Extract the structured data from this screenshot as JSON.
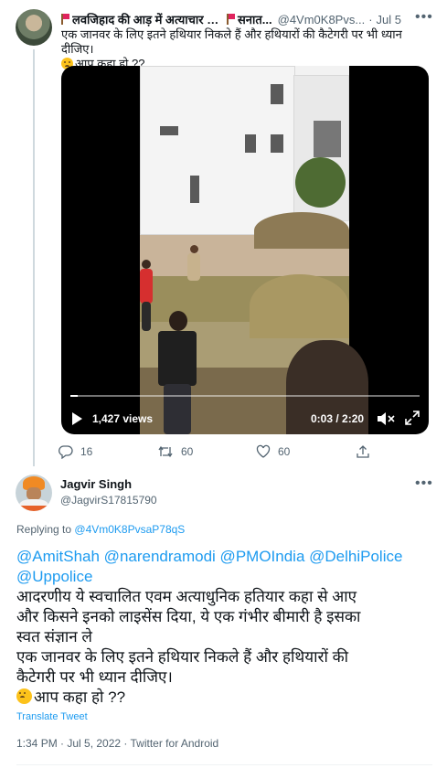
{
  "parent_tweet": {
    "author_name": "लवजिहाद की आड़ में अत्याचार क्यो",
    "author_name_tail": "सनात...",
    "handle": "@4Vm0K8Pvs...",
    "separator": "·",
    "date": "Jul 5",
    "text": "एक जानवर के लिए इतने हथियार निकले हैं और हथियारों की कैटेगरी पर भी ध्यान दीजिए।",
    "text_line2": "आप कहा हो ??",
    "video": {
      "views": "1,427 views",
      "time": "0:03 / 2:20",
      "progress": 0.02
    },
    "actions": {
      "replies": "16",
      "retweets": "60",
      "likes": "60"
    }
  },
  "reply_tweet": {
    "author_name": "Jagvir Singh",
    "handle": "@JagvirS17815790",
    "replying_prefix": "Replying to",
    "replying_to": "@4Vm0K8PvsaP78qS",
    "mentions_line1": "@AmitShah @narendramodi @PMOIndia @DelhiPolice",
    "mentions_line2": "@Uppolice",
    "body_lines": [
      "आदरणीय ये स्वचालित एवम अत्याधुनिक हतियार कहा से आए",
      "और किसने इनको लाइसेंस दिया, ये एक गंभीर बीमारी है इसका",
      "स्वत संज्ञान ले",
      "एक जानवर के लिए इतने हथियार निकले हैं और हथियारों की",
      "कैटेगरी पर भी ध्यान दीजिए।"
    ],
    "body_last": "आप कहा हो ??",
    "translate": "Translate Tweet",
    "meta": "1:34 PM · Jul 5, 2022 · Twitter for Android"
  },
  "icons": {
    "more": "more-horizontal-icon",
    "reply": "reply-bubble-icon",
    "retweet": "retweet-icon",
    "like": "heart-icon",
    "share": "share-icon",
    "emoji": "crying-face-emoji"
  },
  "colors": {
    "link": "#1d9bf0",
    "secondary_text": "#536471",
    "thread_line": "#cfd9de"
  }
}
